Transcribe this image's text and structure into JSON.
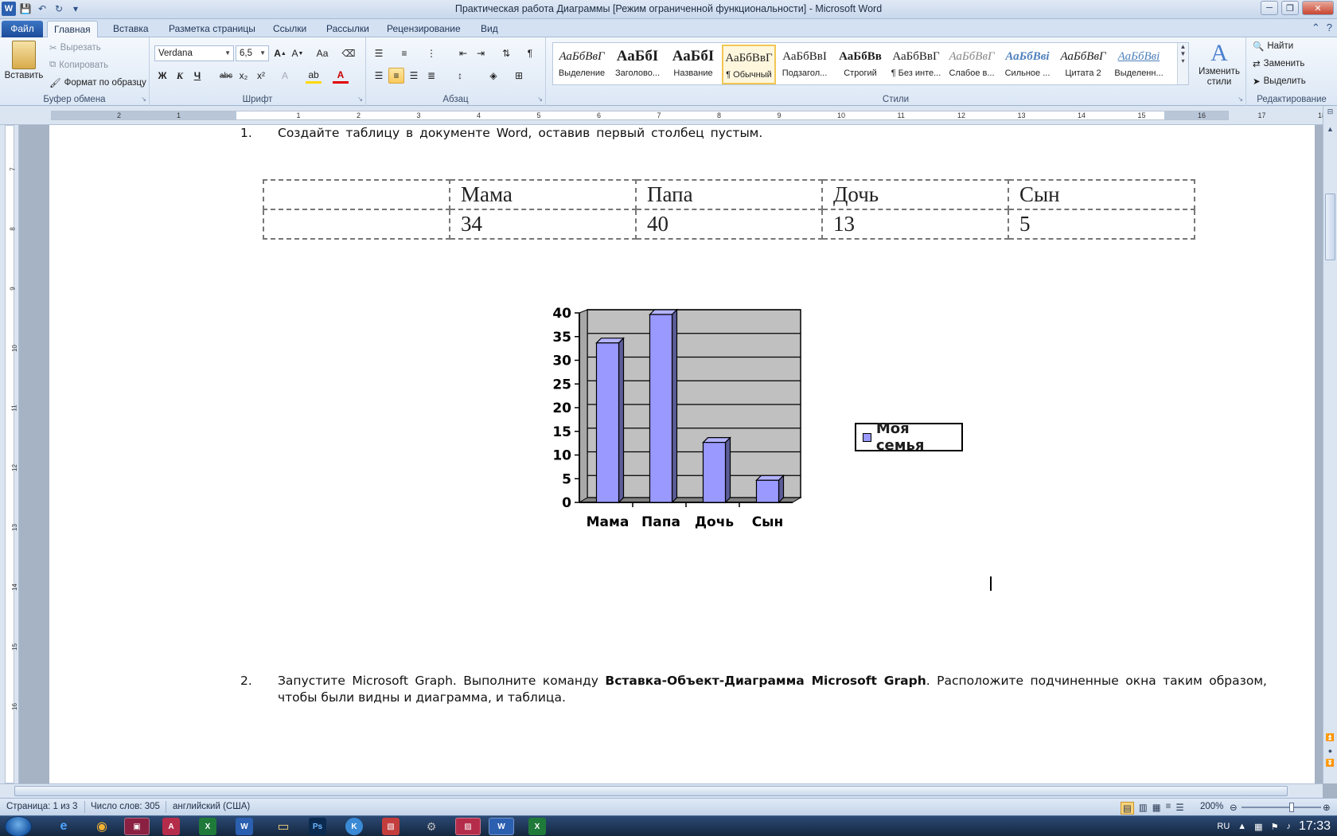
{
  "window": {
    "title": "Практическая работа Диаграммы [Режим ограниченной функциональности]  -  Microsoft Word"
  },
  "tabs": [
    "Файл",
    "Главная",
    "Вставка",
    "Разметка страницы",
    "Ссылки",
    "Рассылки",
    "Рецензирование",
    "Вид"
  ],
  "active_tab": "Главная",
  "clipboard": {
    "paste": "Вставить",
    "cut": "Вырезать",
    "copy": "Копировать",
    "format_painter": "Формат по образцу",
    "label": "Буфер обмена"
  },
  "font": {
    "name": "Verdana",
    "size": "6,5",
    "label": "Шрифт",
    "bold": "Ж",
    "italic": "К",
    "underline": "Ч",
    "change_case": "Аа"
  },
  "paragraph": {
    "label": "Абзац"
  },
  "styles": {
    "label": "Стили",
    "items": [
      {
        "preview": "АаБбВвГ",
        "name": "Выделение"
      },
      {
        "preview": "АаБбI",
        "name": "Заголово..."
      },
      {
        "preview": "АаБбI",
        "name": "Название"
      },
      {
        "preview": "АаБбВвГ",
        "name": "¶ Обычный"
      },
      {
        "preview": "АаБбВвI",
        "name": "Подзагол..."
      },
      {
        "preview": "АаБбВв",
        "name": "Строгий"
      },
      {
        "preview": "АаБбВвГ",
        "name": "¶ Без инте..."
      },
      {
        "preview": "АаБбВвГ",
        "name": "Слабое в..."
      },
      {
        "preview": "АаБбВві",
        "name": "Сильное ..."
      },
      {
        "preview": "АаБбВвГ",
        "name": "Цитата 2"
      },
      {
        "preview": "АаБбВві",
        "name": "Выделенн..."
      }
    ],
    "change": "Изменить стили"
  },
  "editing": {
    "find": "Найти",
    "replace": "Заменить",
    "select": "Выделить",
    "label": "Редактирование"
  },
  "document": {
    "step1_num": "1.",
    "step1": "Создайте таблицу в документе Word, оставив первый столбец пустым.",
    "table": {
      "headers": [
        "",
        "Мама",
        "Папа",
        "Дочь",
        "Сын"
      ],
      "row": [
        "",
        "34",
        "40",
        "13",
        "5"
      ]
    },
    "step2_num": "2.",
    "step2_a": "Запустите Microsoft Graph. Выполните команду ",
    "step2_b": "Вставка-Объект-Диаграмма Microsoft Graph",
    "step2_c": ". Расположите подчиненные окна таким образом, чтобы были видны и диаграмма, и таблица."
  },
  "chart_data": {
    "type": "bar",
    "categories": [
      "Мама",
      "Папа",
      "Дочь",
      "Сын"
    ],
    "series": [
      {
        "name": "Моя семья",
        "values": [
          34,
          40,
          13,
          5
        ]
      }
    ],
    "ylim": [
      0,
      40
    ],
    "yticks": [
      0,
      5,
      10,
      15,
      20,
      25,
      30,
      35,
      40
    ],
    "legend": "right",
    "grid": true,
    "colors": {
      "bar": "#9999ff",
      "plot_bg": "#c0c0c0"
    }
  },
  "status": {
    "page": "Страница: 1 из 3",
    "words": "Число слов: 305",
    "lang": "английский (США)",
    "zoom": "200%"
  },
  "taskbar": {
    "lang": "RU",
    "time": "17:33"
  }
}
